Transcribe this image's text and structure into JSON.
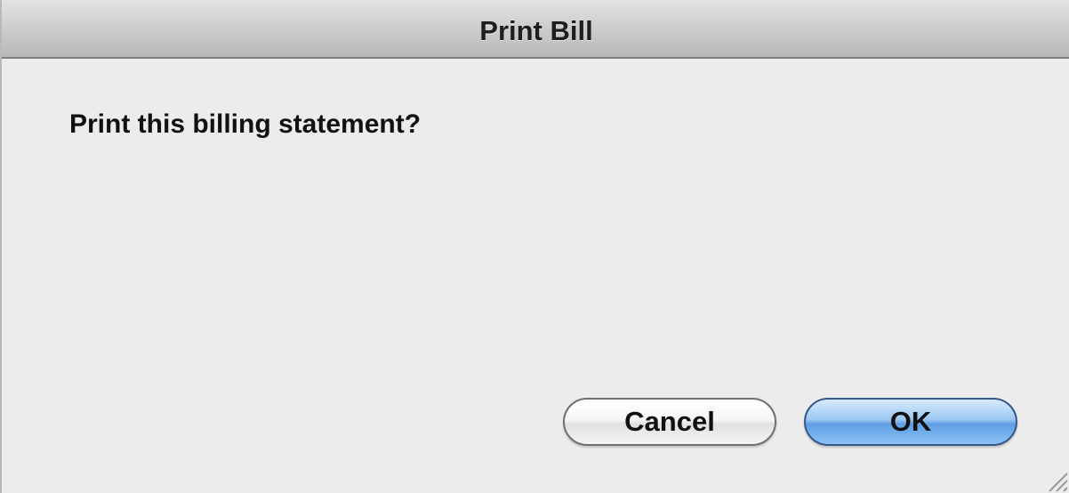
{
  "window": {
    "title": "Print Bill"
  },
  "dialog": {
    "message": "Print this billing statement?"
  },
  "buttons": {
    "cancel_label": "Cancel",
    "ok_label": "OK"
  },
  "icons": {
    "resize": "resize-grip-icon"
  },
  "colors": {
    "default_button": "#6aa8ea",
    "background": "#ececec"
  }
}
